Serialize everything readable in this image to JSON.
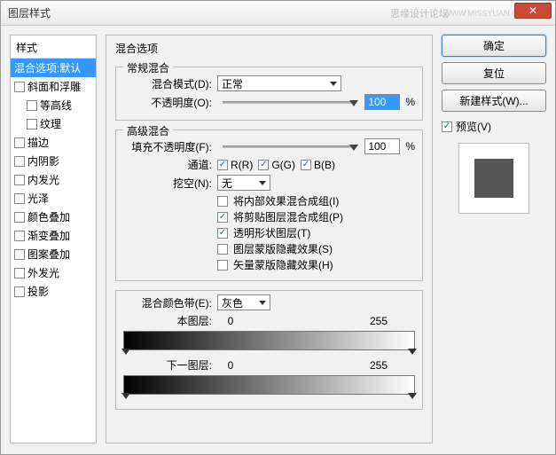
{
  "title": "图层样式",
  "watermark": "思缘设计论坛",
  "watermark_url": "WWW.MISSYUAN.COM",
  "styles_header": "样式",
  "styles": [
    {
      "label": "混合选项:默认",
      "checked": null,
      "selected": true,
      "indent": false
    },
    {
      "label": "斜面和浮雕",
      "checked": false,
      "selected": false,
      "indent": false
    },
    {
      "label": "等高线",
      "checked": false,
      "selected": false,
      "indent": true
    },
    {
      "label": "纹理",
      "checked": false,
      "selected": false,
      "indent": true
    },
    {
      "label": "描边",
      "checked": false,
      "selected": false,
      "indent": false
    },
    {
      "label": "内阴影",
      "checked": false,
      "selected": false,
      "indent": false
    },
    {
      "label": "内发光",
      "checked": false,
      "selected": false,
      "indent": false
    },
    {
      "label": "光泽",
      "checked": false,
      "selected": false,
      "indent": false
    },
    {
      "label": "颜色叠加",
      "checked": false,
      "selected": false,
      "indent": false
    },
    {
      "label": "渐变叠加",
      "checked": false,
      "selected": false,
      "indent": false
    },
    {
      "label": "图案叠加",
      "checked": false,
      "selected": false,
      "indent": false
    },
    {
      "label": "外发光",
      "checked": false,
      "selected": false,
      "indent": false
    },
    {
      "label": "投影",
      "checked": false,
      "selected": false,
      "indent": false
    }
  ],
  "middle": {
    "section_title": "混合选项",
    "general": {
      "legend": "常规混合",
      "blend_mode_label": "混合模式(D):",
      "blend_mode_value": "正常",
      "opacity_label": "不透明度(O):",
      "opacity_value": "100",
      "percent": "%"
    },
    "advanced": {
      "legend": "高级混合",
      "fill_opacity_label": "填充不透明度(F):",
      "fill_opacity_value": "100",
      "percent": "%",
      "channels_label": "通道:",
      "r": "R(R)",
      "g": "G(G)",
      "b": "B(B)",
      "knockout_label": "挖空(N):",
      "knockout_value": "无",
      "opts": [
        {
          "label": "将内部效果混合成组(I)",
          "checked": false
        },
        {
          "label": "将剪贴图层混合成组(P)",
          "checked": true
        },
        {
          "label": "透明形状图层(T)",
          "checked": true
        },
        {
          "label": "图层蒙版隐藏效果(S)",
          "checked": false
        },
        {
          "label": "矢量蒙版隐藏效果(H)",
          "checked": false
        }
      ]
    },
    "blendif": {
      "label": "混合颜色带(E):",
      "value": "灰色",
      "this_layer": "本图层:",
      "this_low": "0",
      "this_high": "255",
      "under_layer": "下一图层:",
      "under_low": "0",
      "under_high": "255"
    }
  },
  "right": {
    "ok": "确定",
    "cancel": "复位",
    "new_style": "新建样式(W)...",
    "preview": "预览(V)"
  }
}
